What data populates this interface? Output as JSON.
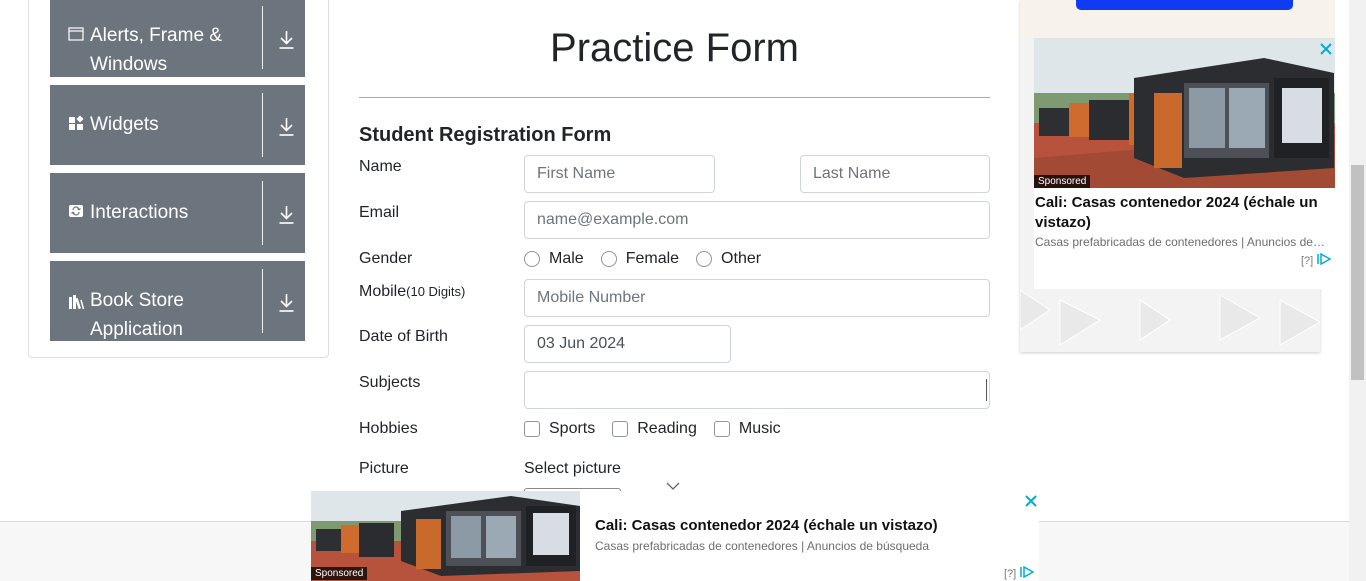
{
  "sidebar": {
    "groups": [
      {
        "label_line1": "Alerts, Frame &",
        "label_line2": "Windows",
        "icon": "window-icon"
      },
      {
        "label_line1": "Widgets",
        "label_line2": "",
        "icon": "widgets-icon"
      },
      {
        "label_line1": "Interactions",
        "label_line2": "",
        "icon": "interactions-icon"
      },
      {
        "label_line1": "Book Store",
        "label_line2": "Application",
        "icon": "books-icon"
      }
    ]
  },
  "main": {
    "title": "Practice Form",
    "form_heading": "Student Registration Form",
    "labels": {
      "name": "Name",
      "email": "Email",
      "gender": "Gender",
      "mobile": "Mobile",
      "mobile_hint": "(10 Digits)",
      "dob": "Date of Birth",
      "subjects": "Subjects",
      "hobbies": "Hobbies",
      "picture": "Picture"
    },
    "placeholders": {
      "first_name": "First Name",
      "last_name": "Last Name",
      "email": "name@example.com",
      "mobile": "Mobile Number"
    },
    "dob_value": "03 Jun 2024",
    "gender_options": [
      "Male",
      "Female",
      "Other"
    ],
    "hobby_options": [
      "Sports",
      "Reading",
      "Music"
    ],
    "select_picture": "Select picture"
  },
  "ad_right": {
    "sponsored": "Sponsored",
    "headline": "Cali: Casas contenedor 2024 (échale un vistazo)",
    "description": "Casas prefabricadas de contenedores | Anuncios de búsqueda",
    "info": "[?]"
  },
  "ad_bottom": {
    "sponsored": "Sponsored",
    "headline": "Cali: Casas contenedor 2024 (échale un vistazo)",
    "description": "Casas prefabricadas de contenedores | Anuncios de búsqueda",
    "info": "[?]"
  },
  "colors": {
    "sidebar_group": "#6c757d",
    "ad_close": "#00aecd",
    "ad_button": "#0f3cf2"
  }
}
